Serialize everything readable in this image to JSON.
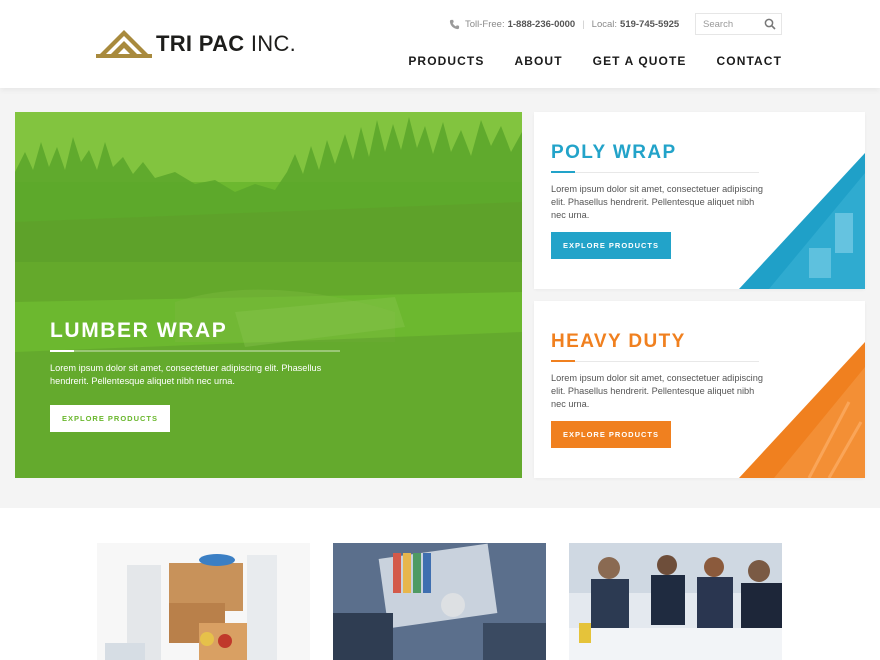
{
  "brand": {
    "logo_text_bold": "TRI PAC",
    "logo_text_light": "INC.",
    "logo_color": "#a88a3d"
  },
  "header": {
    "toll_free_label": "Toll-Free:",
    "toll_free_number": "1-888-236-0000",
    "local_label": "Local:",
    "local_number": "519-745-5925",
    "search_placeholder": "Search"
  },
  "nav": {
    "items": [
      {
        "label": "PRODUCTS"
      },
      {
        "label": "ABOUT"
      },
      {
        "label": "GET A QUOTE"
      },
      {
        "label": "CONTACT"
      }
    ]
  },
  "hero": {
    "title": "LUMBER WRAP",
    "text": "Lorem ipsum dolor sit amet, consectetuer adipiscing elit. Phasellus hendrerit. Pellentesque aliquet nibh nec urna.",
    "button_label": "EXPLORE PRODUCTS",
    "color": "#6ab72d"
  },
  "cards": [
    {
      "title": "POLY WRAP",
      "text": "Lorem ipsum dolor sit amet, consectetuer adipiscing elit. Phasellus hendrerit. Pellentesque aliquet nibh nec urna.",
      "button_label": "EXPLORE PRODUCTS",
      "color": "#22a3c9"
    },
    {
      "title": "HEAVY DUTY",
      "text": "Lorem ipsum dolor sit amet, consectetuer adipiscing elit. Phasellus hendrerit. Pellentesque aliquet nibh nec urna.",
      "button_label": "EXPLORE PRODUCTS",
      "color": "#f0801f"
    }
  ],
  "thumbnails": [
    {
      "icon": "packaging-products-photo"
    },
    {
      "icon": "design-table-photo"
    },
    {
      "icon": "business-team-photo"
    }
  ],
  "icons": {
    "phone": "phone-icon",
    "search": "search-icon"
  }
}
